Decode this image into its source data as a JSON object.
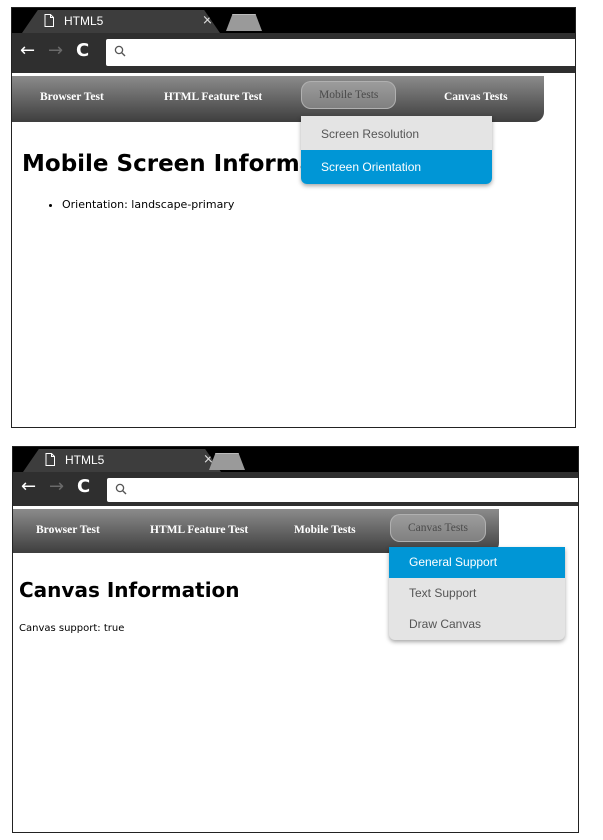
{
  "browser": {
    "tab_title": "HTML5",
    "tab_close": "×",
    "nav": {
      "back": "←",
      "forward": "→",
      "reload": "C"
    },
    "address_value": ""
  },
  "screen1": {
    "menu": [
      "Browser Test",
      "HTML Feature Test",
      "Mobile Tests",
      "Canvas Tests"
    ],
    "active_menu": "Mobile Tests",
    "dropdown": [
      {
        "label": "Screen Resolution",
        "selected": false
      },
      {
        "label": "Screen Orientation",
        "selected": true
      }
    ],
    "heading": "Mobile Screen Information",
    "list": [
      "Orientation: landscape-primary"
    ]
  },
  "screen2": {
    "menu": [
      "Browser Test",
      "HTML Feature Test",
      "Mobile Tests",
      "Canvas Tests"
    ],
    "active_menu": "Canvas Tests",
    "dropdown": [
      {
        "label": "General Support",
        "selected": true
      },
      {
        "label": "Text Support",
        "selected": false
      },
      {
        "label": "Draw Canvas",
        "selected": false
      }
    ],
    "heading": "Canvas Information",
    "body_text": "Canvas support: true"
  },
  "colors": {
    "accent": "#0096d6",
    "menubar_top": "#8b8b8b",
    "menubar_bottom": "#3e3e3e"
  }
}
